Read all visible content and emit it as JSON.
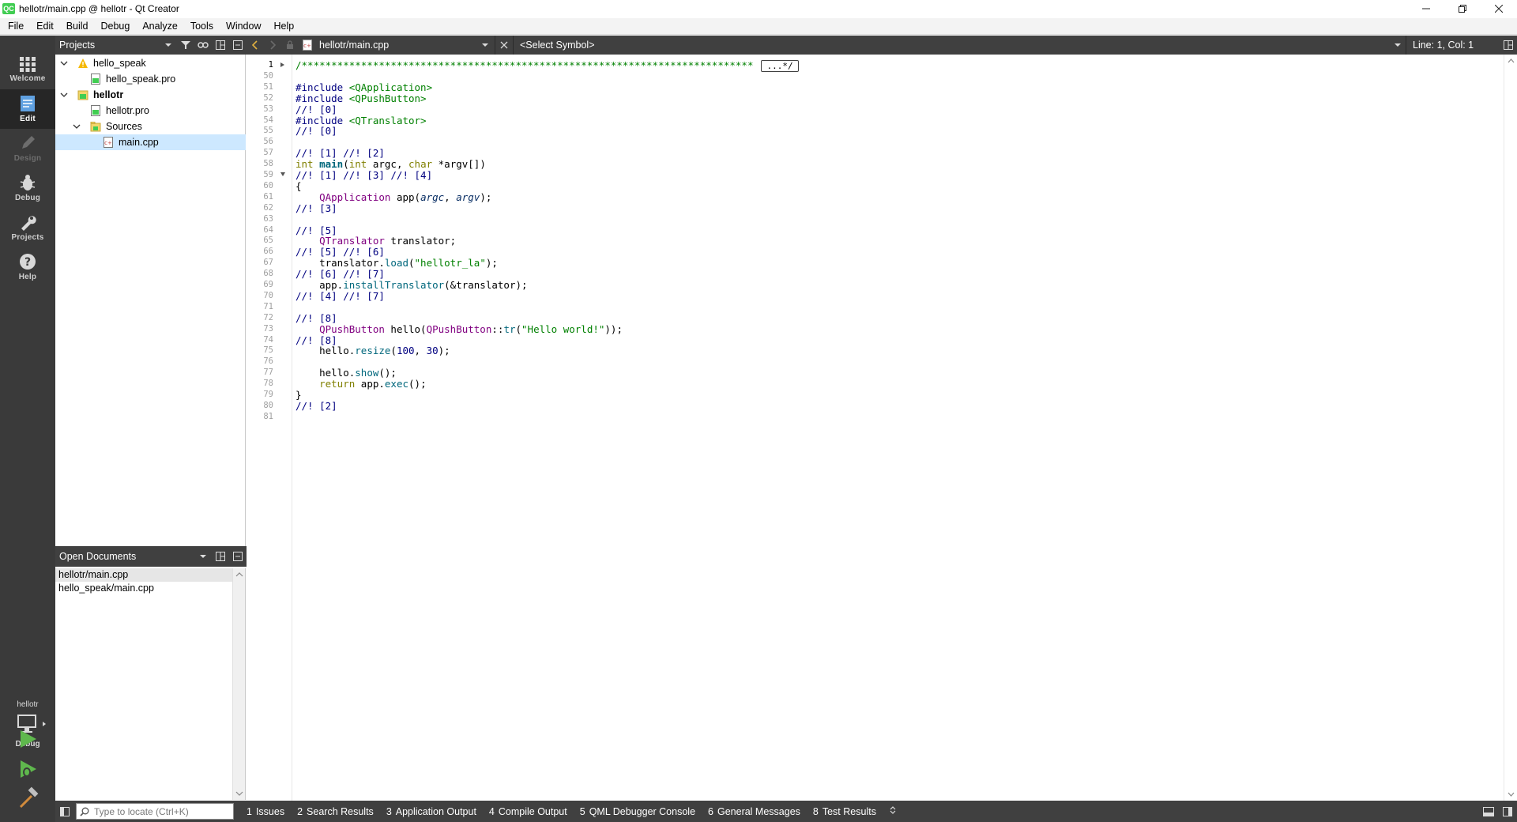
{
  "window": {
    "title": "hellotr/main.cpp @ hellotr - Qt Creator",
    "logo_text": "QC"
  },
  "menu": [
    "File",
    "Edit",
    "Build",
    "Debug",
    "Analyze",
    "Tools",
    "Window",
    "Help"
  ],
  "modes": [
    {
      "label": "Welcome",
      "icon": "grid-icon",
      "state": "normal"
    },
    {
      "label": "Edit",
      "icon": "document-edit-icon",
      "state": "active"
    },
    {
      "label": "Design",
      "icon": "pencil-icon",
      "state": "disabled"
    },
    {
      "label": "Debug",
      "icon": "bug-icon",
      "state": "normal"
    },
    {
      "label": "Projects",
      "icon": "wrench-icon",
      "state": "normal"
    },
    {
      "label": "Help",
      "icon": "help-icon",
      "state": "normal"
    }
  ],
  "kit": {
    "project": "hellotr",
    "build_mode": "Debug"
  },
  "projects_pane": {
    "title": "Projects",
    "tree": [
      {
        "label": "hello_speak",
        "depth": 0,
        "expanded": true,
        "icon": "warning-icon",
        "bold": false,
        "selected": false
      },
      {
        "label": "hello_speak.pro",
        "depth": 1,
        "expanded": null,
        "icon": "pro-file-icon",
        "bold": false,
        "selected": false
      },
      {
        "label": "hellotr",
        "depth": 0,
        "expanded": true,
        "icon": "project-folder-icon",
        "bold": true,
        "selected": false
      },
      {
        "label": "hellotr.pro",
        "depth": 1,
        "expanded": null,
        "icon": "pro-file-icon",
        "bold": false,
        "selected": false
      },
      {
        "label": "Sources",
        "depth": 1,
        "expanded": true,
        "icon": "folder-icon",
        "bold": false,
        "selected": false
      },
      {
        "label": "main.cpp",
        "depth": 2,
        "expanded": null,
        "icon": "cpp-file-icon",
        "bold": false,
        "selected": true
      }
    ]
  },
  "open_documents": {
    "title": "Open Documents",
    "items": [
      {
        "label": "hellotr/main.cpp",
        "selected": true
      },
      {
        "label": "hello_speak/main.cpp",
        "selected": false
      }
    ]
  },
  "editor_toolbar": {
    "file": "hellotr/main.cpp",
    "symbol": "<Select Symbol>",
    "line_col": "Line: 1, Col: 1"
  },
  "editor": {
    "current_line": 1,
    "folded_marker": "...*/",
    "lines": [
      {
        "n": "1",
        "fold": "right"
      },
      {
        "n": "50",
        "fold": ""
      },
      {
        "n": "51",
        "fold": ""
      },
      {
        "n": "52",
        "fold": ""
      },
      {
        "n": "53",
        "fold": ""
      },
      {
        "n": "54",
        "fold": ""
      },
      {
        "n": "55",
        "fold": ""
      },
      {
        "n": "56",
        "fold": ""
      },
      {
        "n": "57",
        "fold": ""
      },
      {
        "n": "58",
        "fold": ""
      },
      {
        "n": "59",
        "fold": "down"
      },
      {
        "n": "60",
        "fold": ""
      },
      {
        "n": "61",
        "fold": ""
      },
      {
        "n": "62",
        "fold": ""
      },
      {
        "n": "63",
        "fold": ""
      },
      {
        "n": "64",
        "fold": ""
      },
      {
        "n": "65",
        "fold": ""
      },
      {
        "n": "66",
        "fold": ""
      },
      {
        "n": "67",
        "fold": ""
      },
      {
        "n": "68",
        "fold": ""
      },
      {
        "n": "69",
        "fold": ""
      },
      {
        "n": "70",
        "fold": ""
      },
      {
        "n": "71",
        "fold": ""
      },
      {
        "n": "72",
        "fold": ""
      },
      {
        "n": "73",
        "fold": ""
      },
      {
        "n": "74",
        "fold": ""
      },
      {
        "n": "75",
        "fold": ""
      },
      {
        "n": "76",
        "fold": ""
      },
      {
        "n": "77",
        "fold": ""
      },
      {
        "n": "78",
        "fold": ""
      },
      {
        "n": "79",
        "fold": ""
      },
      {
        "n": "80",
        "fold": ""
      },
      {
        "n": "81",
        "fold": ""
      }
    ],
    "code": [
      [
        [
          "stars",
          "/****************************************************************************"
        ],
        [
          "marker",
          "...*/"
        ]
      ],
      [],
      [
        [
          "pre",
          "#include "
        ],
        [
          "inc",
          "<QApplication>"
        ]
      ],
      [
        [
          "pre",
          "#include "
        ],
        [
          "inc",
          "<QPushButton>"
        ]
      ],
      [
        [
          "comment",
          "//! [0]"
        ]
      ],
      [
        [
          "pre",
          "#include "
        ],
        [
          "inc",
          "<QTranslator>"
        ]
      ],
      [
        [
          "comment",
          "//! [0]"
        ]
      ],
      [],
      [
        [
          "comment",
          "//! [1] //! [2]"
        ]
      ],
      [
        [
          "kw",
          "int "
        ],
        [
          "bold",
          "main"
        ],
        [
          "var",
          "("
        ],
        [
          "kw",
          "int "
        ],
        [
          "var",
          "argc, "
        ],
        [
          "kw",
          "char "
        ],
        [
          "var",
          "*argv[])"
        ]
      ],
      [
        [
          "comment",
          "//! [1] //! [3] //! [4]"
        ]
      ],
      [
        [
          "var",
          "{"
        ]
      ],
      [
        [
          "var",
          "    "
        ],
        [
          "type",
          "QApplication "
        ],
        [
          "var",
          "app("
        ],
        [
          "param",
          "argc"
        ],
        [
          "var",
          ", "
        ],
        [
          "param",
          "argv"
        ],
        [
          "var",
          ");"
        ]
      ],
      [
        [
          "comment",
          "//! [3]"
        ]
      ],
      [],
      [
        [
          "comment",
          "//! [5]"
        ]
      ],
      [
        [
          "var",
          "    "
        ],
        [
          "type",
          "QTranslator "
        ],
        [
          "var",
          "translator;"
        ]
      ],
      [
        [
          "comment",
          "//! [5] //! [6]"
        ]
      ],
      [
        [
          "var",
          "    translator."
        ],
        [
          "fn",
          "load"
        ],
        [
          "var",
          "("
        ],
        [
          "str",
          "\"hellotr_la\""
        ],
        [
          "var",
          ");"
        ]
      ],
      [
        [
          "comment",
          "//! [6] //! [7]"
        ]
      ],
      [
        [
          "var",
          "    app."
        ],
        [
          "fn",
          "installTranslator"
        ],
        [
          "var",
          "(&translator);"
        ]
      ],
      [
        [
          "comment",
          "//! [4] //! [7]"
        ]
      ],
      [],
      [
        [
          "comment",
          "//! [8]"
        ]
      ],
      [
        [
          "var",
          "    "
        ],
        [
          "type",
          "QPushButton "
        ],
        [
          "var",
          "hello("
        ],
        [
          "type",
          "QPushButton"
        ],
        [
          "var",
          "::"
        ],
        [
          "fn",
          "tr"
        ],
        [
          "var",
          "("
        ],
        [
          "str",
          "\"Hello world!\""
        ],
        [
          "var",
          "));"
        ]
      ],
      [
        [
          "comment",
          "//! [8]"
        ]
      ],
      [
        [
          "var",
          "    hello."
        ],
        [
          "fn",
          "resize"
        ],
        [
          "var",
          "("
        ],
        [
          "num",
          "100"
        ],
        [
          "var",
          ", "
        ],
        [
          "num",
          "30"
        ],
        [
          "var",
          ");"
        ]
      ],
      [],
      [
        [
          "var",
          "    hello."
        ],
        [
          "fn",
          "show"
        ],
        [
          "var",
          "();"
        ]
      ],
      [
        [
          "kw",
          "    return "
        ],
        [
          "var",
          "app."
        ],
        [
          "fn",
          "exec"
        ],
        [
          "var",
          "();"
        ]
      ],
      [
        [
          "var",
          "}"
        ]
      ],
      [
        [
          "comment",
          "//! [2]"
        ]
      ],
      []
    ]
  },
  "bottom_bar": {
    "locator_placeholder": "Type to locate (Ctrl+K)",
    "tabs": [
      {
        "num": "1",
        "label": "Issues"
      },
      {
        "num": "2",
        "label": "Search Results"
      },
      {
        "num": "3",
        "label": "Application Output"
      },
      {
        "num": "4",
        "label": "Compile Output"
      },
      {
        "num": "5",
        "label": "QML Debugger Console"
      },
      {
        "num": "6",
        "label": "General Messages"
      },
      {
        "num": "8",
        "label": "Test Results"
      }
    ]
  },
  "colors": {
    "sidebar": "#3a3a3a",
    "sidebar_active": "#262626",
    "toolbar": "#404040",
    "selection": "#cde8ff",
    "run_green": "#5fb84d",
    "comment": "#000080",
    "keyword": "#808000",
    "type": "#800080",
    "string": "#008000"
  }
}
